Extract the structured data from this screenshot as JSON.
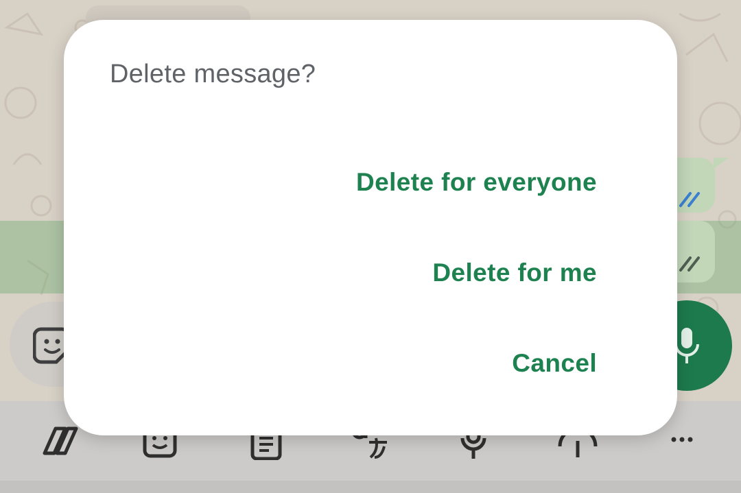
{
  "dialog": {
    "title": "Delete message?",
    "actions": {
      "delete_for_everyone": "Delete for everyone",
      "delete_for_me": "Delete for me",
      "cancel": "Cancel"
    }
  },
  "colors": {
    "accent": "#1e8250",
    "title_text": "#5f6368",
    "mic_button": "#1d7a4c",
    "selected_highlight": "#78af78"
  },
  "icons": {
    "composer": [
      "sticker-icon",
      "microphone-icon"
    ],
    "keyboard_toolbar": [
      "copilot-icon",
      "emoji-sparkle-icon",
      "clipboard-icon",
      "translate-icon",
      "microphone-icon",
      "info-icon",
      "more-icon"
    ]
  }
}
